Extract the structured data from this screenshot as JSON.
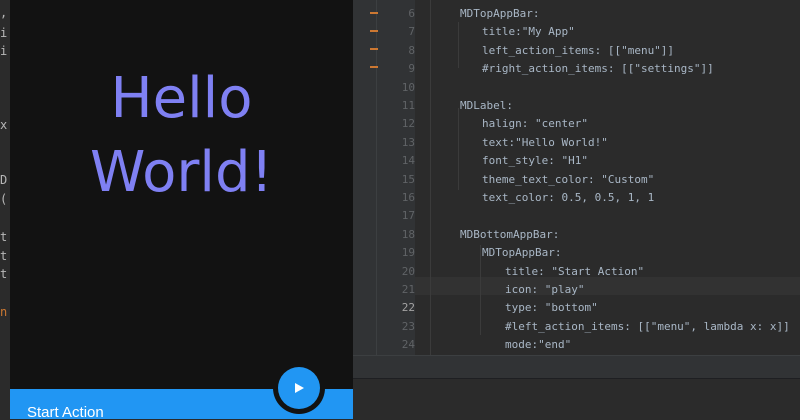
{
  "left_fragments": [
    ",",
    "i",
    "i",
    "x",
    "D",
    "(",
    "t",
    "t",
    "t",
    "n"
  ],
  "app": {
    "label_text": "Hello\nWorld!",
    "bottom_bar_title": "Start Action",
    "fab_icon": "play-icon",
    "colors": {
      "label": "#7f80f3",
      "bar": "#2196f3",
      "background": "#121212"
    }
  },
  "editor": {
    "current_line": "22",
    "lines": [
      {
        "num": "6",
        "text": "MDTopAppBar:"
      },
      {
        "num": "7",
        "text": "title:\"My App\""
      },
      {
        "num": "8",
        "text": "left_action_items: [[\"menu\"]]"
      },
      {
        "num": "9",
        "text": "#right_action_items: [[\"settings\"]]"
      },
      {
        "num": "10",
        "text": ""
      },
      {
        "num": "11",
        "text": "MDLabel:"
      },
      {
        "num": "12",
        "text": "halign: \"center\""
      },
      {
        "num": "13",
        "text": "text:\"Hello World!\""
      },
      {
        "num": "14",
        "text": "font_style: \"H1\""
      },
      {
        "num": "15",
        "text": "theme_text_color: \"Custom\""
      },
      {
        "num": "16",
        "text": "text_color: 0.5, 0.5, 1, 1"
      },
      {
        "num": "17",
        "text": ""
      },
      {
        "num": "18",
        "text": "MDBottomAppBar:"
      },
      {
        "num": "19",
        "text": "MDTopAppBar:"
      },
      {
        "num": "20",
        "text": "title: \"Start Action\""
      },
      {
        "num": "21",
        "text": "icon: \"play\""
      },
      {
        "num": "22",
        "text": "type: \"bottom\""
      },
      {
        "num": "23",
        "text": "#left_action_items: [[\"menu\", lambda x: x]]"
      },
      {
        "num": "24",
        "text": "mode:\"end\""
      }
    ]
  }
}
